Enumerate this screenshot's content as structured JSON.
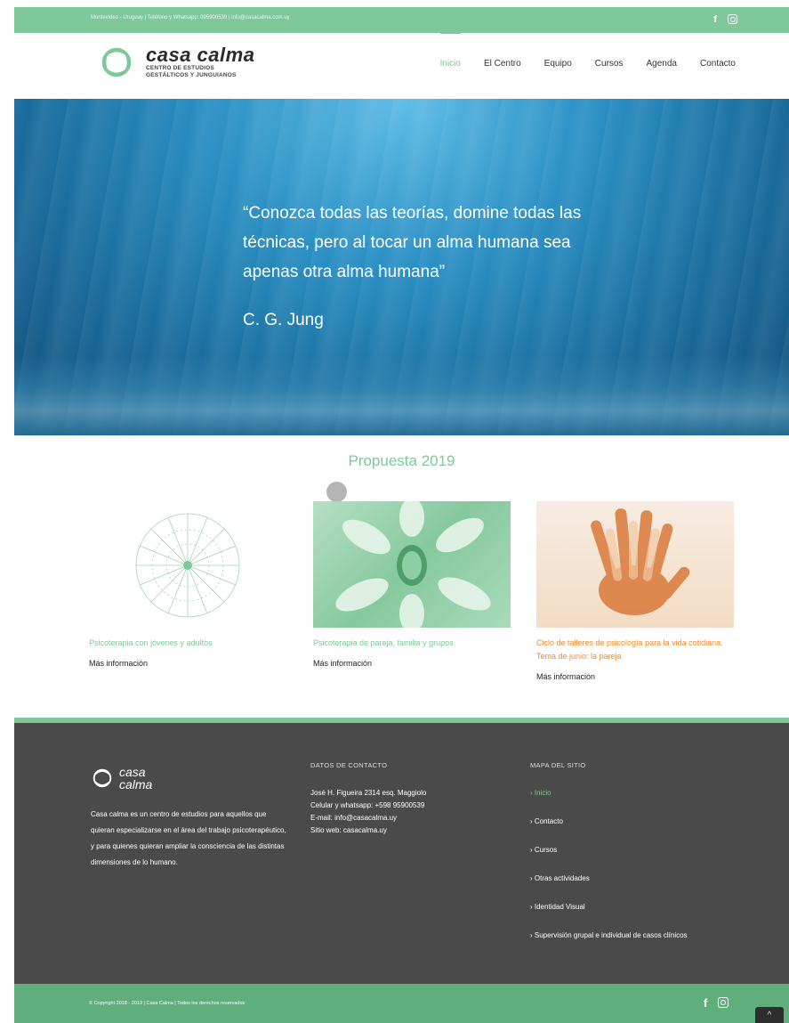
{
  "topbar": {
    "info": "Montevideo - Uruguay | Teléfono y Whatsapp: 095900539 | info@casacalma.com.uy",
    "facebook_icon": "f",
    "instagram_icon": "instagram-icon"
  },
  "header": {
    "brand_name": "casa calma",
    "brand_line1": "CENTRO DE ESTUDIOS",
    "brand_line2": "GESTÁLTICOS Y JUNGUIANOS",
    "nav": [
      "Inicio",
      "El Centro",
      "Equipo",
      "Cursos",
      "Agenda",
      "Contacto"
    ],
    "active_nav": "Inicio"
  },
  "hero": {
    "quote": "“Conozca todas las teorías, domine todas las técnicas, pero al tocar un alma humana sea apenas otra alma humana”",
    "author": "C. G. Jung"
  },
  "section": {
    "title": "Propuesta 2019",
    "cards": [
      {
        "title": "Psicoterapia con jóvenes y adultos",
        "more": "Más información"
      },
      {
        "title": "Psicoterapia de pareja, familia y grupos",
        "more": "Más información"
      },
      {
        "title": "Ciclo de talleres de psicología para la vida cotidiana. Tema de junio: la pareja",
        "more": "Más información"
      }
    ]
  },
  "footer": {
    "brand_line1": "casa",
    "brand_line2": "calma",
    "about": "Casa calma es un centro de estudios para aquellos que quieran especializarse en el área del trabajo psicoterapéutico, y para quienes quieran ampliar la consciencia de las distintas dimensiones de lo humano.",
    "contact_heading": "DATOS DE CONTACTO",
    "contact": [
      "José H. Figueira 2314 esq. Maggiolo",
      "Celular y whatsapp: +598 95900539",
      "E-mail: info@casacalma.uy",
      "Sitio web: casacalma.uy"
    ],
    "sitemap_heading": "MAPA DEL SITIO",
    "sitemap": [
      "› Inicio",
      "› Contacto",
      "› Cursos",
      "› Otras actividades",
      "› Identidad Visual",
      "› Supervisión grupal e individual de casos clínicos"
    ]
  },
  "bottombar": {
    "copyright": "© Copyright 2018 - 2019 | Casa Calma | Todos los derechos reservados",
    "facebook_icon": "f",
    "to_top": "^"
  },
  "colors": {
    "accent": "#7ec89a",
    "orange": "#f08a2a",
    "footer": "#4a4a4a"
  }
}
